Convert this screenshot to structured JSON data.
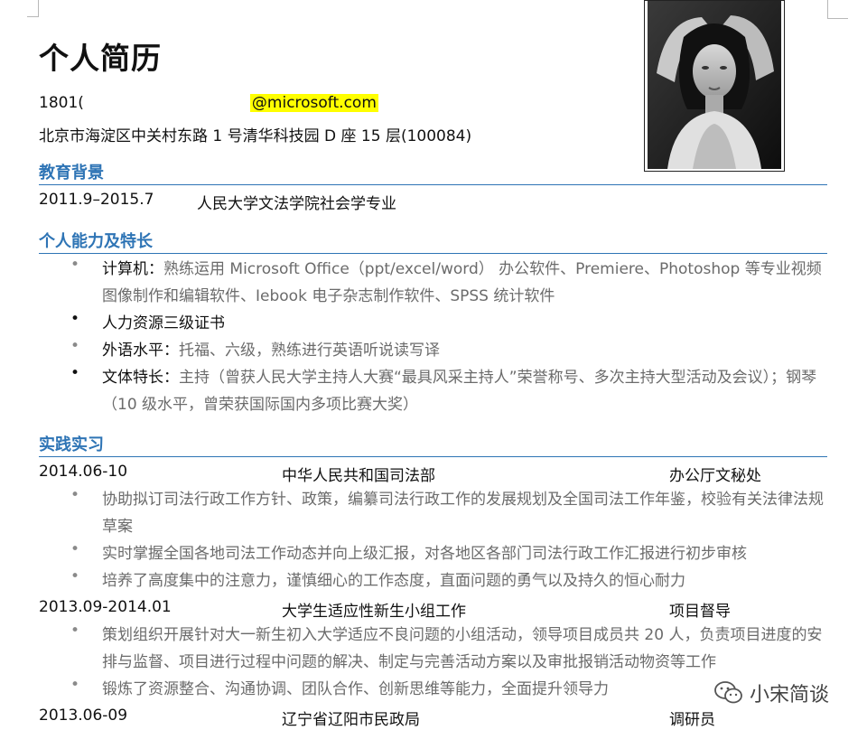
{
  "resume": {
    "title": "个人简历",
    "phone": "1801(",
    "email": "@microsoft.com",
    "address": "北京市海淀区中关村东路 1 号清华科技园 D 座 15 层(100084)"
  },
  "education": {
    "heading": "教育背景",
    "dates": "2011.9–2015.7",
    "school": "人民大学文法学院社会学专业"
  },
  "skills": {
    "heading": "个人能力及特长",
    "items": [
      {
        "label": "计算机：",
        "text": "熟练运用 Microsoft Office（ppt/excel/word） 办公软件、Premiere、Photoshop 等专业视频图像制作和编辑软件、Iebook 电子杂志制作软件、SPSS 统计软件"
      },
      {
        "label": "",
        "text": "人力资源三级证书"
      },
      {
        "label": "外语水平：",
        "text": "托福、六级，熟练进行英语听说读写译"
      },
      {
        "label": "文体特长：",
        "text": "主持（曾获人民大学主持人大赛“最具风采主持人”荣誉称号、多次主持大型活动及会议）；钢琴（10 级水平，曾荣获国际国内多项比赛大奖）"
      }
    ]
  },
  "practice": {
    "heading": "实践实习",
    "jobs": [
      {
        "date": "2014.06-10",
        "org": "中华人民共和国司法部",
        "role": "办公厅文秘处",
        "bullets": [
          "协助拟订司法行政工作方针、政策，编纂司法行政工作的发展规划及全国司法工作年鉴，校验有关法律法规草案",
          "实时掌握全国各地司法工作动态并向上级汇报，对各地区各部门司法行政工作汇报进行初步审核",
          "培养了高度集中的注意力，谨慎细心的工作态度，直面问题的勇气以及持久的恒心耐力"
        ]
      },
      {
        "date": "2013.09-2014.01",
        "org": "大学生适应性新生小组工作",
        "role": "项目督导",
        "bullets": [
          "策划组织开展针对大一新生初入大学适应不良问题的小组活动，领导项目成员共 20 人，负责项目进度的安排与监督、项目进行过程中问题的解决、制定与完善活动方案以及审批报销活动物资等工作",
          "锻炼了资源整合、沟通协调、团队合作、创新思维等能力，全面提升领导力"
        ]
      },
      {
        "date": "2013.06-09",
        "org": "辽宁省辽阳市民政局",
        "role": "调研员",
        "bullets": []
      }
    ]
  },
  "watermark": {
    "text": "小宋简谈",
    "icon": "wechat-icon"
  },
  "photo": {
    "icon": "portrait-photo"
  },
  "colors": {
    "heading": "#2e74b5",
    "highlight": "#ffff00",
    "gray_text": "#6b6b6b"
  }
}
